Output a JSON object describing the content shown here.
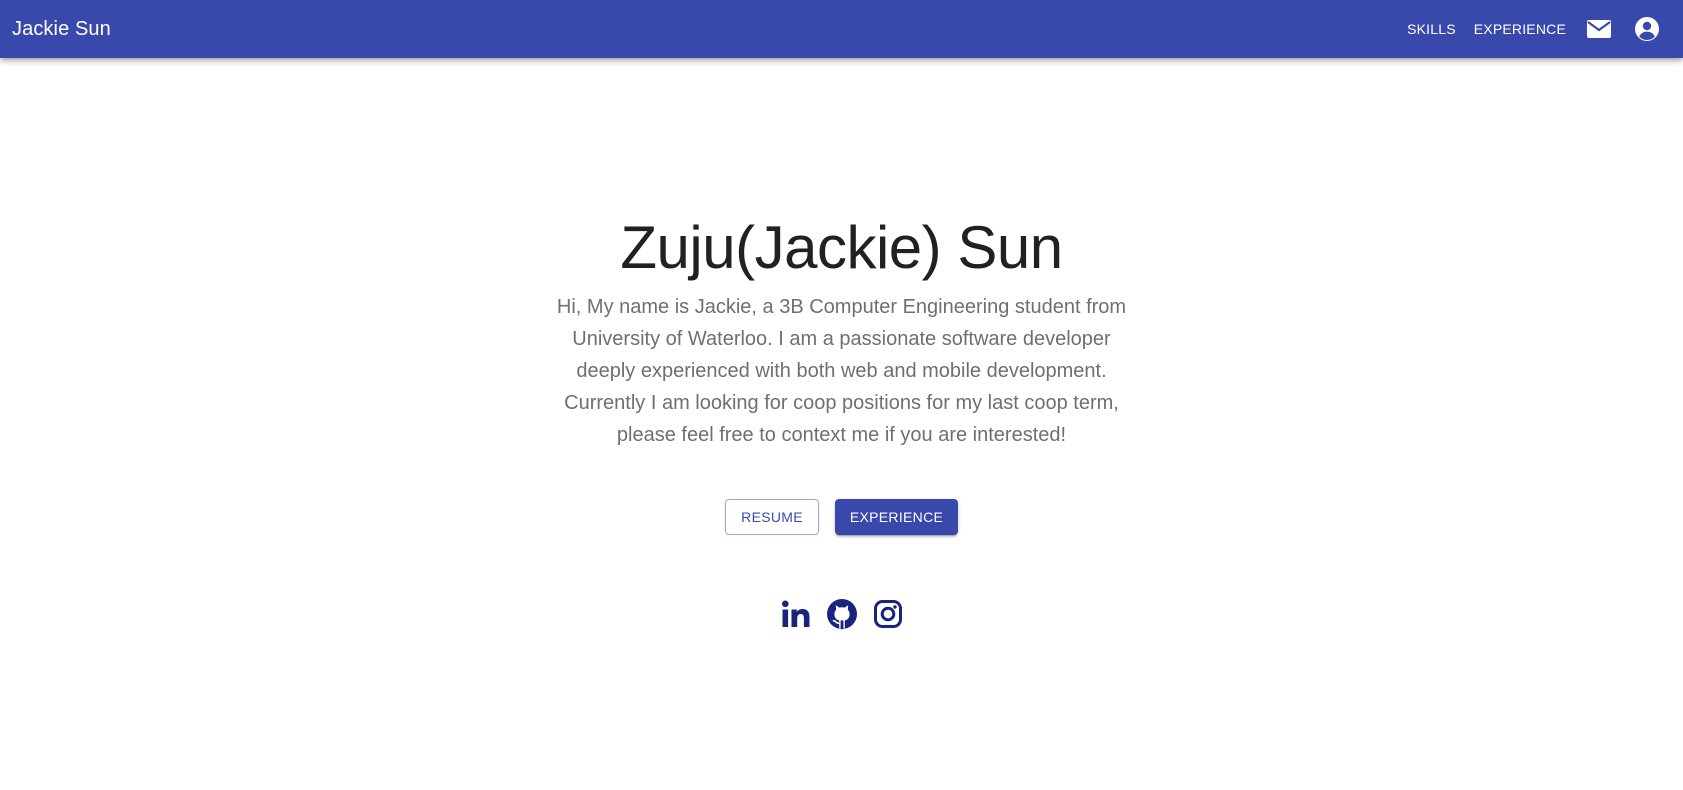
{
  "header": {
    "brand": "Jackie Sun",
    "nav": [
      {
        "label": "SKILLS"
      },
      {
        "label": "EXPERIENCE"
      }
    ],
    "icons": [
      "mail-icon",
      "account-circle-icon"
    ]
  },
  "hero": {
    "title": "Zuju(Jackie) Sun",
    "description_lines": [
      "Hi, My name is Jackie, a 3B Computer Engineering student from",
      "University of Waterloo. I am a passionate software developer",
      "deeply experienced with both web and mobile development.",
      "Currently I am looking for coop positions for my last coop term,",
      "please feel free to context me if you are interested!"
    ]
  },
  "actions": {
    "resume_label": "RESUME",
    "experience_label": "EXPERIENCE"
  },
  "socials": [
    "linkedin-icon",
    "github-icon",
    "instagram-icon"
  ],
  "colors": {
    "primary": "#3949ab",
    "social_icon": "#1a237e",
    "text_title": "#212121",
    "text_body": "#6f6f6f"
  }
}
